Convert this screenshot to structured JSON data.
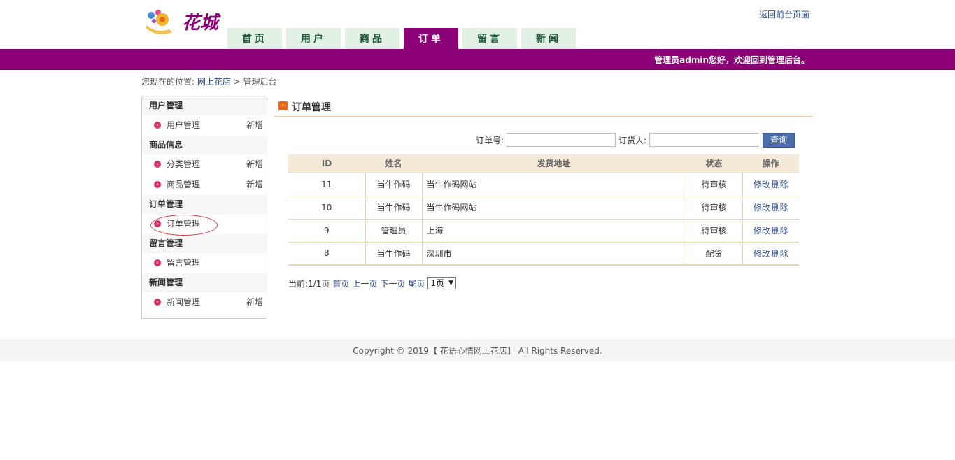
{
  "header": {
    "back_link": "返回前台页面",
    "nav": [
      {
        "label": "首页"
      },
      {
        "label": "用户"
      },
      {
        "label": "商品"
      },
      {
        "label": "订单"
      },
      {
        "label": "留言"
      },
      {
        "label": "新闻"
      }
    ],
    "active_tab": "订单",
    "welcome": "管理员admin您好，欢迎回到管理后台。",
    "logo_text": "花城"
  },
  "breadcrumb": {
    "prefix": "您现在的位置:",
    "home": "网上花店",
    "sep": ">",
    "current": "管理后台"
  },
  "sidebar": {
    "groups": [
      {
        "title": "用户管理",
        "items": [
          {
            "label": "用户管理",
            "action": "新增"
          }
        ]
      },
      {
        "title": "商品信息",
        "items": [
          {
            "label": "分类管理",
            "action": "新增"
          },
          {
            "label": "商品管理",
            "action": "新增"
          }
        ]
      },
      {
        "title": "订单管理",
        "items": [
          {
            "label": "订单管理",
            "action": ""
          }
        ]
      },
      {
        "title": "留言管理",
        "items": [
          {
            "label": "留言管理",
            "action": ""
          }
        ]
      },
      {
        "title": "新闻管理",
        "items": [
          {
            "label": "新闻管理",
            "action": "新增"
          }
        ]
      }
    ]
  },
  "main": {
    "title": "订单管理",
    "search": {
      "order_label": "订单号:",
      "order_value": "",
      "person_label": "订货人:",
      "person_value": "",
      "button": "查询"
    },
    "table": {
      "headers": [
        "ID",
        "姓名",
        "发货地址",
        "状态",
        "操作"
      ],
      "rows": [
        {
          "id": "11",
          "name": "当牛作码",
          "address": "当牛作码网站",
          "status": "待审核",
          "edit": "修改",
          "delete": "删除"
        },
        {
          "id": "10",
          "name": "当牛作码",
          "address": "当牛作码网站",
          "status": "待审核",
          "edit": "修改",
          "delete": "删除"
        },
        {
          "id": "9",
          "name": "管理员",
          "address": "上海",
          "status": "待审核",
          "edit": "修改",
          "delete": "删除"
        },
        {
          "id": "8",
          "name": "当牛作码",
          "address": "深圳市",
          "status": "配货",
          "edit": "修改",
          "delete": "删除"
        }
      ]
    },
    "pager": {
      "current": "当前:1/1页",
      "first": "首页",
      "prev": "上一页",
      "next": "下一页",
      "last": "尾页",
      "select_value": "1页"
    }
  },
  "footer": {
    "text": "Copyright © 2019【 花语心情网上花店】 All Rights Reserved."
  },
  "colors": {
    "brand_purple": "#8b0077",
    "tab_green": "#e2f1e4",
    "link_blue": "#2b4a8a",
    "table_head": "#f5ead8"
  }
}
